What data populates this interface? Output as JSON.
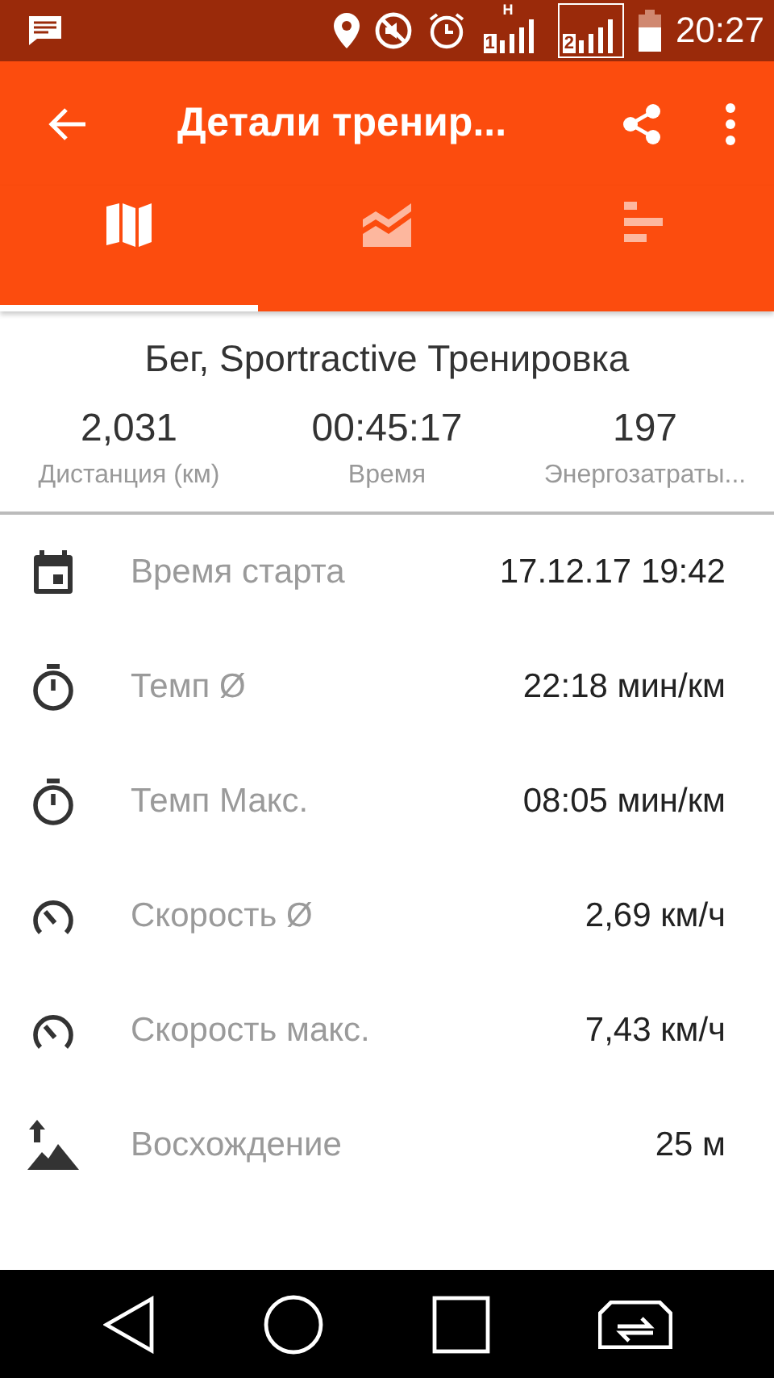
{
  "status_bar": {
    "sim1": "1",
    "network": "H",
    "sim2": "2",
    "time": "20:27"
  },
  "toolbar": {
    "title": "Детали тренир..."
  },
  "tabs": [
    {
      "kind": "map",
      "selected": true
    },
    {
      "kind": "chart",
      "selected": false
    },
    {
      "kind": "bars",
      "selected": false
    }
  ],
  "summary": {
    "title": "Бег, Sportractive Тренировка",
    "stats": [
      {
        "value": "2,031",
        "label": "Дистанция (км)"
      },
      {
        "value": "00:45:17",
        "label": "Время"
      },
      {
        "value": "197",
        "label": "Энергозатраты..."
      }
    ]
  },
  "details": [
    {
      "kind": "date",
      "label": "Время старта",
      "value": "17.12.17 19:42"
    },
    {
      "kind": "pace",
      "label": "Темп Ø",
      "value": "22:18 мин/км"
    },
    {
      "kind": "pace",
      "label": "Темп Макс.",
      "value": "08:05 мин/км"
    },
    {
      "kind": "speed",
      "label": "Скорость Ø",
      "value": "2,69 км/ч"
    },
    {
      "kind": "speed",
      "label": "Скорость макс.",
      "value": "7,43 км/ч"
    },
    {
      "kind": "ascent",
      "label": "Восхождение",
      "value": "25 м"
    }
  ]
}
